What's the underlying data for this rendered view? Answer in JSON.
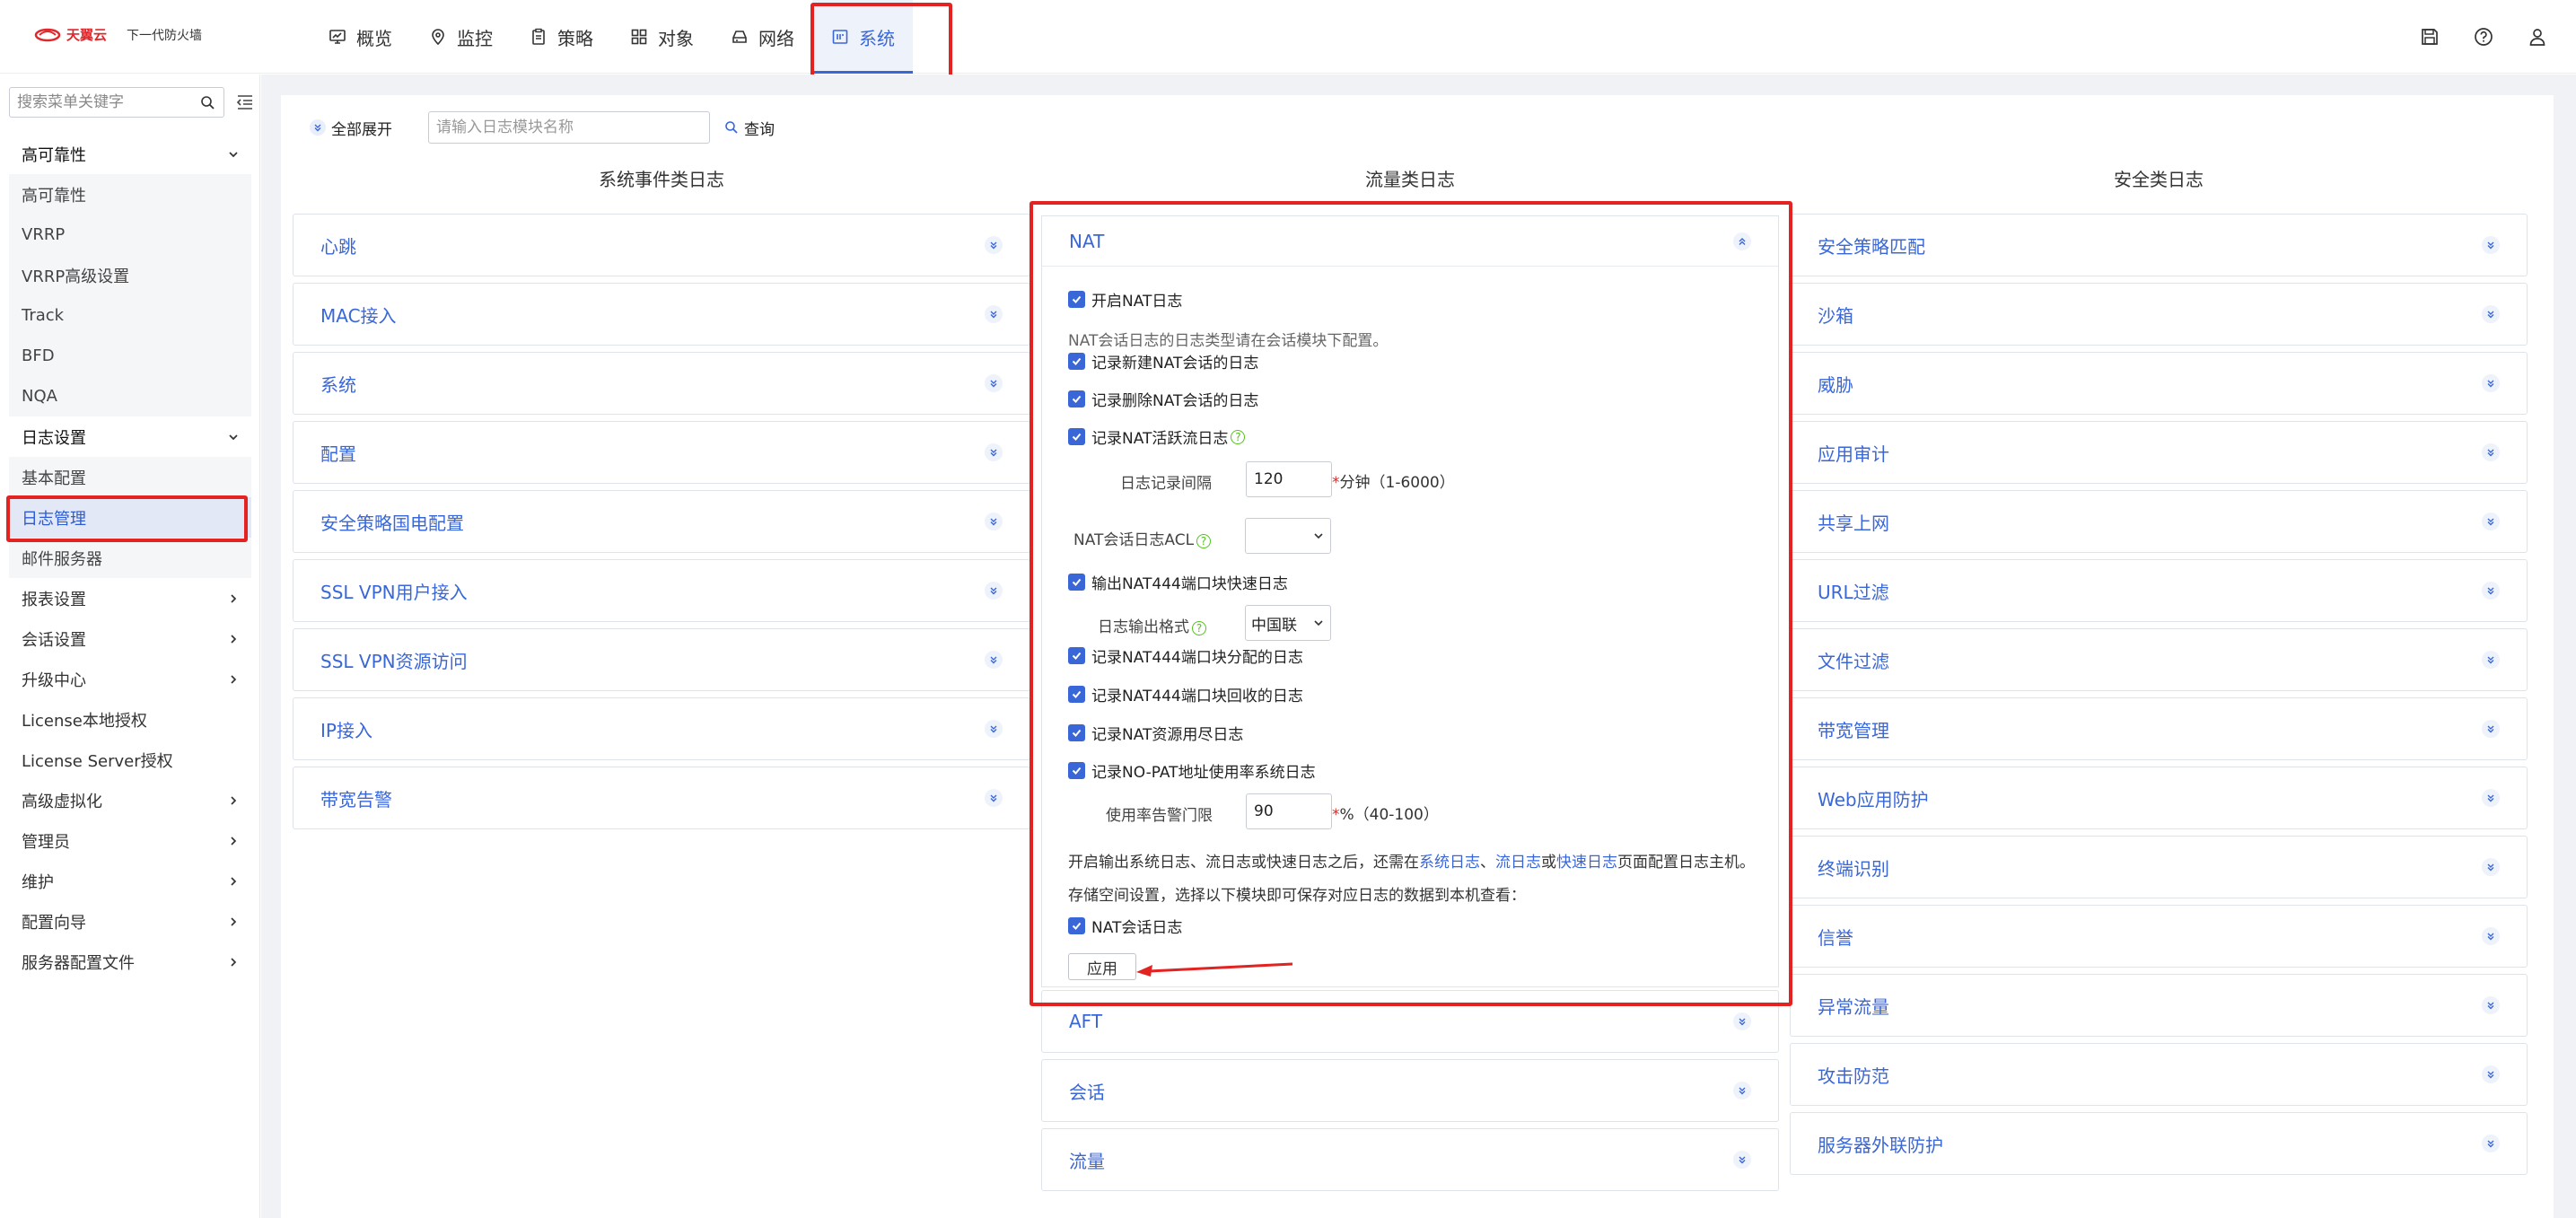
{
  "brand": {
    "logo_text": "天翼云",
    "product": "下一代防火墙"
  },
  "topnav": [
    {
      "label": "概览",
      "icon": "overview-icon"
    },
    {
      "label": "监控",
      "icon": "monitor-icon"
    },
    {
      "label": "策略",
      "icon": "policy-icon"
    },
    {
      "label": "对象",
      "icon": "object-icon"
    },
    {
      "label": "网络",
      "icon": "network-icon"
    },
    {
      "label": "系统",
      "icon": "system-icon",
      "active": true
    }
  ],
  "sidebar": {
    "search_placeholder": "搜索菜单关键字",
    "items": [
      {
        "label": "高可靠性",
        "type": "group",
        "expanded": true
      },
      {
        "label": "高可靠性",
        "type": "sub"
      },
      {
        "label": "VRRP",
        "type": "sub"
      },
      {
        "label": "VRRP高级设置",
        "type": "sub"
      },
      {
        "label": "Track",
        "type": "sub"
      },
      {
        "label": "BFD",
        "type": "sub"
      },
      {
        "label": "NQA",
        "type": "sub"
      },
      {
        "label": "日志设置",
        "type": "group",
        "expanded": true
      },
      {
        "label": "基本配置",
        "type": "sub"
      },
      {
        "label": "日志管理",
        "type": "sub",
        "active": true
      },
      {
        "label": "邮件服务器",
        "type": "sub"
      },
      {
        "label": "报表设置",
        "type": "group"
      },
      {
        "label": "会话设置",
        "type": "group"
      },
      {
        "label": "升级中心",
        "type": "group"
      },
      {
        "label": "License本地授权",
        "type": "leaf"
      },
      {
        "label": "License Server授权",
        "type": "leaf"
      },
      {
        "label": "高级虚拟化",
        "type": "group"
      },
      {
        "label": "管理员",
        "type": "group"
      },
      {
        "label": "维护",
        "type": "group"
      },
      {
        "label": "配置向导",
        "type": "group"
      },
      {
        "label": "服务器配置文件",
        "type": "group"
      }
    ]
  },
  "toolbar": {
    "expand_all": "全部展开",
    "module_search_placeholder": "请输入日志模块名称",
    "query": "查询"
  },
  "columns": {
    "system_events": {
      "title": "系统事件类日志",
      "panels": [
        "心跳",
        "MAC接入",
        "系统",
        "配置",
        "安全策略国电配置",
        "SSL VPN用户接入",
        "SSL VPN资源访问",
        "IP接入",
        "带宽告警"
      ]
    },
    "traffic": {
      "title": "流量类日志",
      "panels_after": [
        "AFT",
        "会话",
        "流量"
      ]
    },
    "security": {
      "title": "安全类日志",
      "panels": [
        "安全策略匹配",
        "沙箱",
        "威胁",
        "应用审计",
        "共享上网",
        "URL过滤",
        "文件过滤",
        "带宽管理",
        "Web应用防护",
        "终端识别",
        "信誉",
        "异常流量",
        "攻击防范",
        "服务器外联防护"
      ]
    }
  },
  "nat": {
    "title": "NAT",
    "enable_log": "开启NAT日志",
    "session_note": "NAT会话日志的日志类型请在会话模块下配置。",
    "log_new_session": "记录新建NAT会话的日志",
    "log_delete_session": "记录删除NAT会话的日志",
    "log_active_flow": "记录NAT活跃流日志",
    "interval_label": "日志记录间隔",
    "interval_value": "120",
    "interval_unit": "分钟（1-6000）",
    "acl_label": "NAT会话日志ACL",
    "acl_value": "",
    "output_444": "输出NAT444端口块快速日志",
    "format_label": "日志输出格式",
    "format_value": "中国联",
    "log_444_alloc": "记录NAT444端口块分配的日志",
    "log_444_recycle": "记录NAT444端口块回收的日志",
    "log_resource_exhaust": "记录NAT资源用尽日志",
    "log_nopat_usage": "记录NO-PAT地址使用率系统日志",
    "threshold_label": "使用率告警门限",
    "threshold_value": "90",
    "threshold_unit": "%（40-100）",
    "info_prefix": "开启输出系统日志、流日志或快速日志之后，还需在",
    "link_system_log": "系统日志",
    "sep1": "、",
    "link_flow_log": "流日志",
    "sep2": "或",
    "link_fast_log": "快速日志",
    "info_suffix": "页面配置日志主机。",
    "storage_note": "存储空间设置，选择以下模块即可保存对应日志的数据到本机查看：",
    "save_session_log": "NAT会话日志",
    "apply": "应用"
  },
  "colors": {
    "accent": "#3a67d8",
    "highlight": "#e32222",
    "help": "#52c41a"
  }
}
